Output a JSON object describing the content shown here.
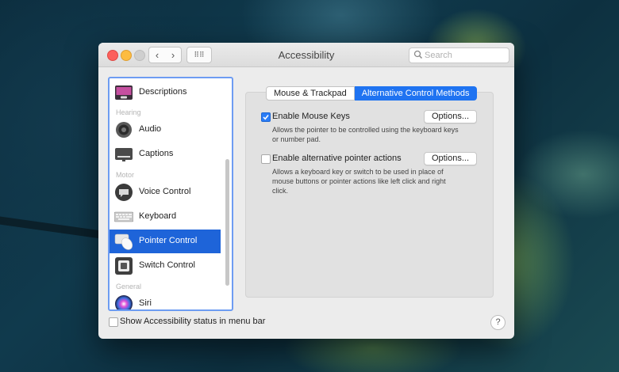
{
  "window": {
    "title": "Accessibility",
    "search_placeholder": "Search",
    "back_glyph": "‹",
    "forward_glyph": "›",
    "grid_glyph": "⠿⠿"
  },
  "sidebar": {
    "items": [
      {
        "label": "Descriptions",
        "icon": "descriptions-icon",
        "selected": false
      },
      {
        "label": "Audio",
        "icon": "speaker-icon",
        "selected": false
      },
      {
        "label": "Captions",
        "icon": "captions-icon",
        "selected": false
      },
      {
        "label": "Voice Control",
        "icon": "voice-control-icon",
        "selected": false
      },
      {
        "label": "Keyboard",
        "icon": "keyboard-icon",
        "selected": false
      },
      {
        "label": "Pointer Control",
        "icon": "pointer-control-icon",
        "selected": true
      },
      {
        "label": "Switch Control",
        "icon": "switch-control-icon",
        "selected": false
      },
      {
        "label": "Siri",
        "icon": "siri-icon",
        "selected": false
      }
    ],
    "sections": [
      "Hearing",
      "Motor",
      "General"
    ]
  },
  "tabs": [
    {
      "label": "Mouse & Trackpad",
      "active": false
    },
    {
      "label": "Alternative Control Methods",
      "active": true
    }
  ],
  "options": {
    "mouse_keys": {
      "label": "Enable Mouse Keys",
      "checked": true,
      "button": "Options...",
      "description": "Allows the pointer to be controlled using the keyboard keys or number pad."
    },
    "alt_pointer": {
      "label": "Enable alternative pointer actions",
      "checked": false,
      "button": "Options...",
      "description": "Allows a keyboard key or switch to be used in place of mouse buttons or pointer actions like left click and right click."
    }
  },
  "footer": {
    "status_label": "Show Accessibility status in menu bar",
    "status_checked": false,
    "help": "?"
  },
  "colors": {
    "accent": "#1f73f1",
    "selection": "#1e64d9"
  }
}
